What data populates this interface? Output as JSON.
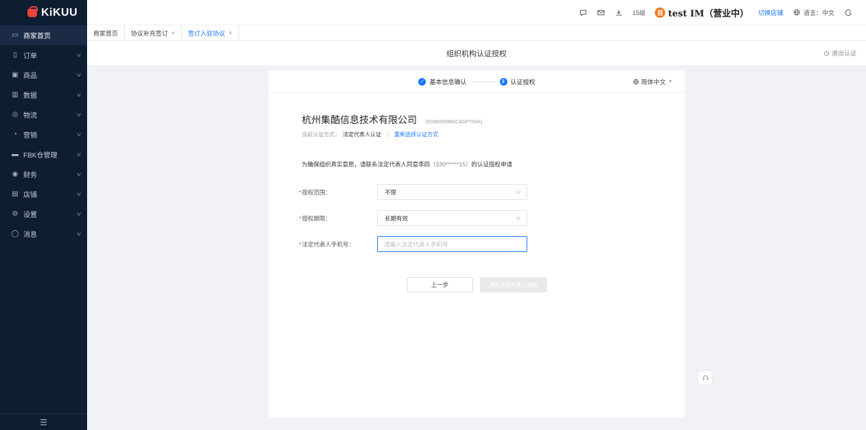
{
  "app": {
    "logo_text": "KiKUU"
  },
  "sidebar": {
    "items": [
      {
        "label": "商家首页",
        "icon": "monitor-icon",
        "glyph": "▭"
      },
      {
        "label": "订单",
        "icon": "order-icon",
        "glyph": "▯"
      },
      {
        "label": "商品",
        "icon": "product-icon",
        "glyph": "▣"
      },
      {
        "label": "数据",
        "icon": "chart-icon",
        "glyph": "▥"
      },
      {
        "label": "物流",
        "icon": "location-icon",
        "glyph": "◎"
      },
      {
        "label": "营销",
        "icon": "marketing-icon",
        "glyph": "◔"
      },
      {
        "label": "FBK仓管理",
        "icon": "warehouse-icon",
        "glyph": "▬"
      },
      {
        "label": "财务",
        "icon": "finance-icon",
        "glyph": "◉"
      },
      {
        "label": "店铺",
        "icon": "store-icon",
        "glyph": "▤"
      },
      {
        "label": "设置",
        "icon": "settings-icon",
        "glyph": "⚙"
      },
      {
        "label": "消息",
        "icon": "message-icon",
        "glyph": "◯"
      }
    ],
    "collapse_glyph": "☰"
  },
  "header": {
    "level": "15级",
    "shop_initial": "目",
    "shop_name": "test IM（营业中）",
    "switch_shop": "切换店铺",
    "language": "语言：中文"
  },
  "tabs": [
    {
      "label": "商家首页",
      "closable": false
    },
    {
      "label": "协议补充签订",
      "closable": true
    },
    {
      "label": "签订入驻协议",
      "closable": true,
      "active": true
    }
  ],
  "page": {
    "title": "组织机构认证授权",
    "exit_label": "退出认证"
  },
  "steps": [
    {
      "label": "基本信息确认",
      "status": "done",
      "mark": "✓"
    },
    {
      "label": "认证授权",
      "status": "current",
      "mark": "2"
    }
  ],
  "lang_select": {
    "value": "简体中文"
  },
  "company": {
    "name": "杭州集酷信息技术有限公司",
    "code": "(92460000MACAGPY93A)"
  },
  "auth_method": {
    "label": "当前认证方式：",
    "value": "法定代表人认证",
    "relink": "重新选择认证方式"
  },
  "notice": {
    "prefix": "为确保组织真实意愿，请联系法定代表人同意李四",
    "masked": "（330******15）",
    "suffix": "的认证授权申请"
  },
  "form": {
    "scope": {
      "label": "授权范围：",
      "value": "不限"
    },
    "period": {
      "label": "授权期限：",
      "value": "长期有效"
    },
    "phone": {
      "label": "法定代表人手机号：",
      "placeholder": "请输入法定代表人手机号",
      "value": ""
    }
  },
  "buttons": {
    "prev": "上一步",
    "notify": "通知法定代表人授权"
  },
  "colors": {
    "primary": "#1677ff",
    "sidebar_bg": "#0f1d33",
    "required": "#e5393a",
    "shop_avatar": "#f07a1a"
  }
}
